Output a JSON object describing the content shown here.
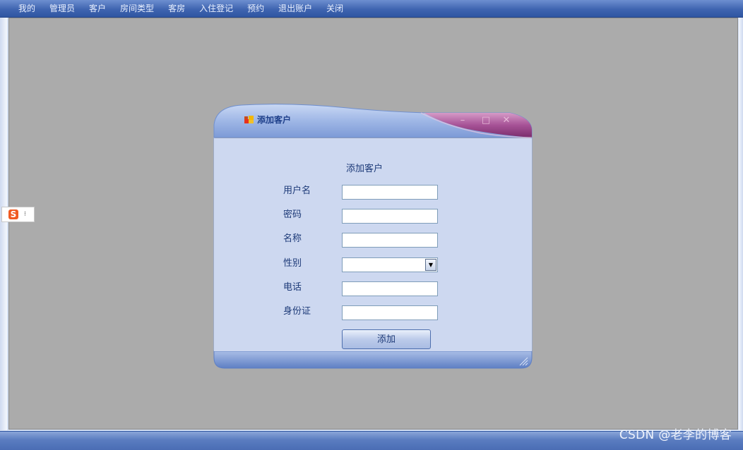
{
  "menubar": {
    "items": [
      "我的",
      "管理员",
      "客户",
      "房间类型",
      "客房",
      "入住登记",
      "预约",
      "退出账户",
      "关闭"
    ]
  },
  "dialog": {
    "title": "添加客户",
    "form_heading": "添加客户",
    "fields": {
      "username_label": "用户名",
      "password_label": "密码",
      "name_label": "名称",
      "gender_label": "性别",
      "phone_label": "电话",
      "idcard_label": "身份证"
    },
    "values": {
      "username": "",
      "password": "",
      "name": "",
      "gender": "",
      "phone": "",
      "idcard": ""
    },
    "submit_label": "添加",
    "window_buttons": {
      "minimize": "–",
      "maximize": "□",
      "close": "✕"
    }
  },
  "ime": {
    "logo": "S",
    "arrow": "⁝"
  },
  "watermark": "CSDN @老李的博客",
  "colors": {
    "menubar": "#3f64b0",
    "mdi_background": "#ababab",
    "dialog_body": "#cdd8f0",
    "title_accent": "#8a3d7e"
  }
}
